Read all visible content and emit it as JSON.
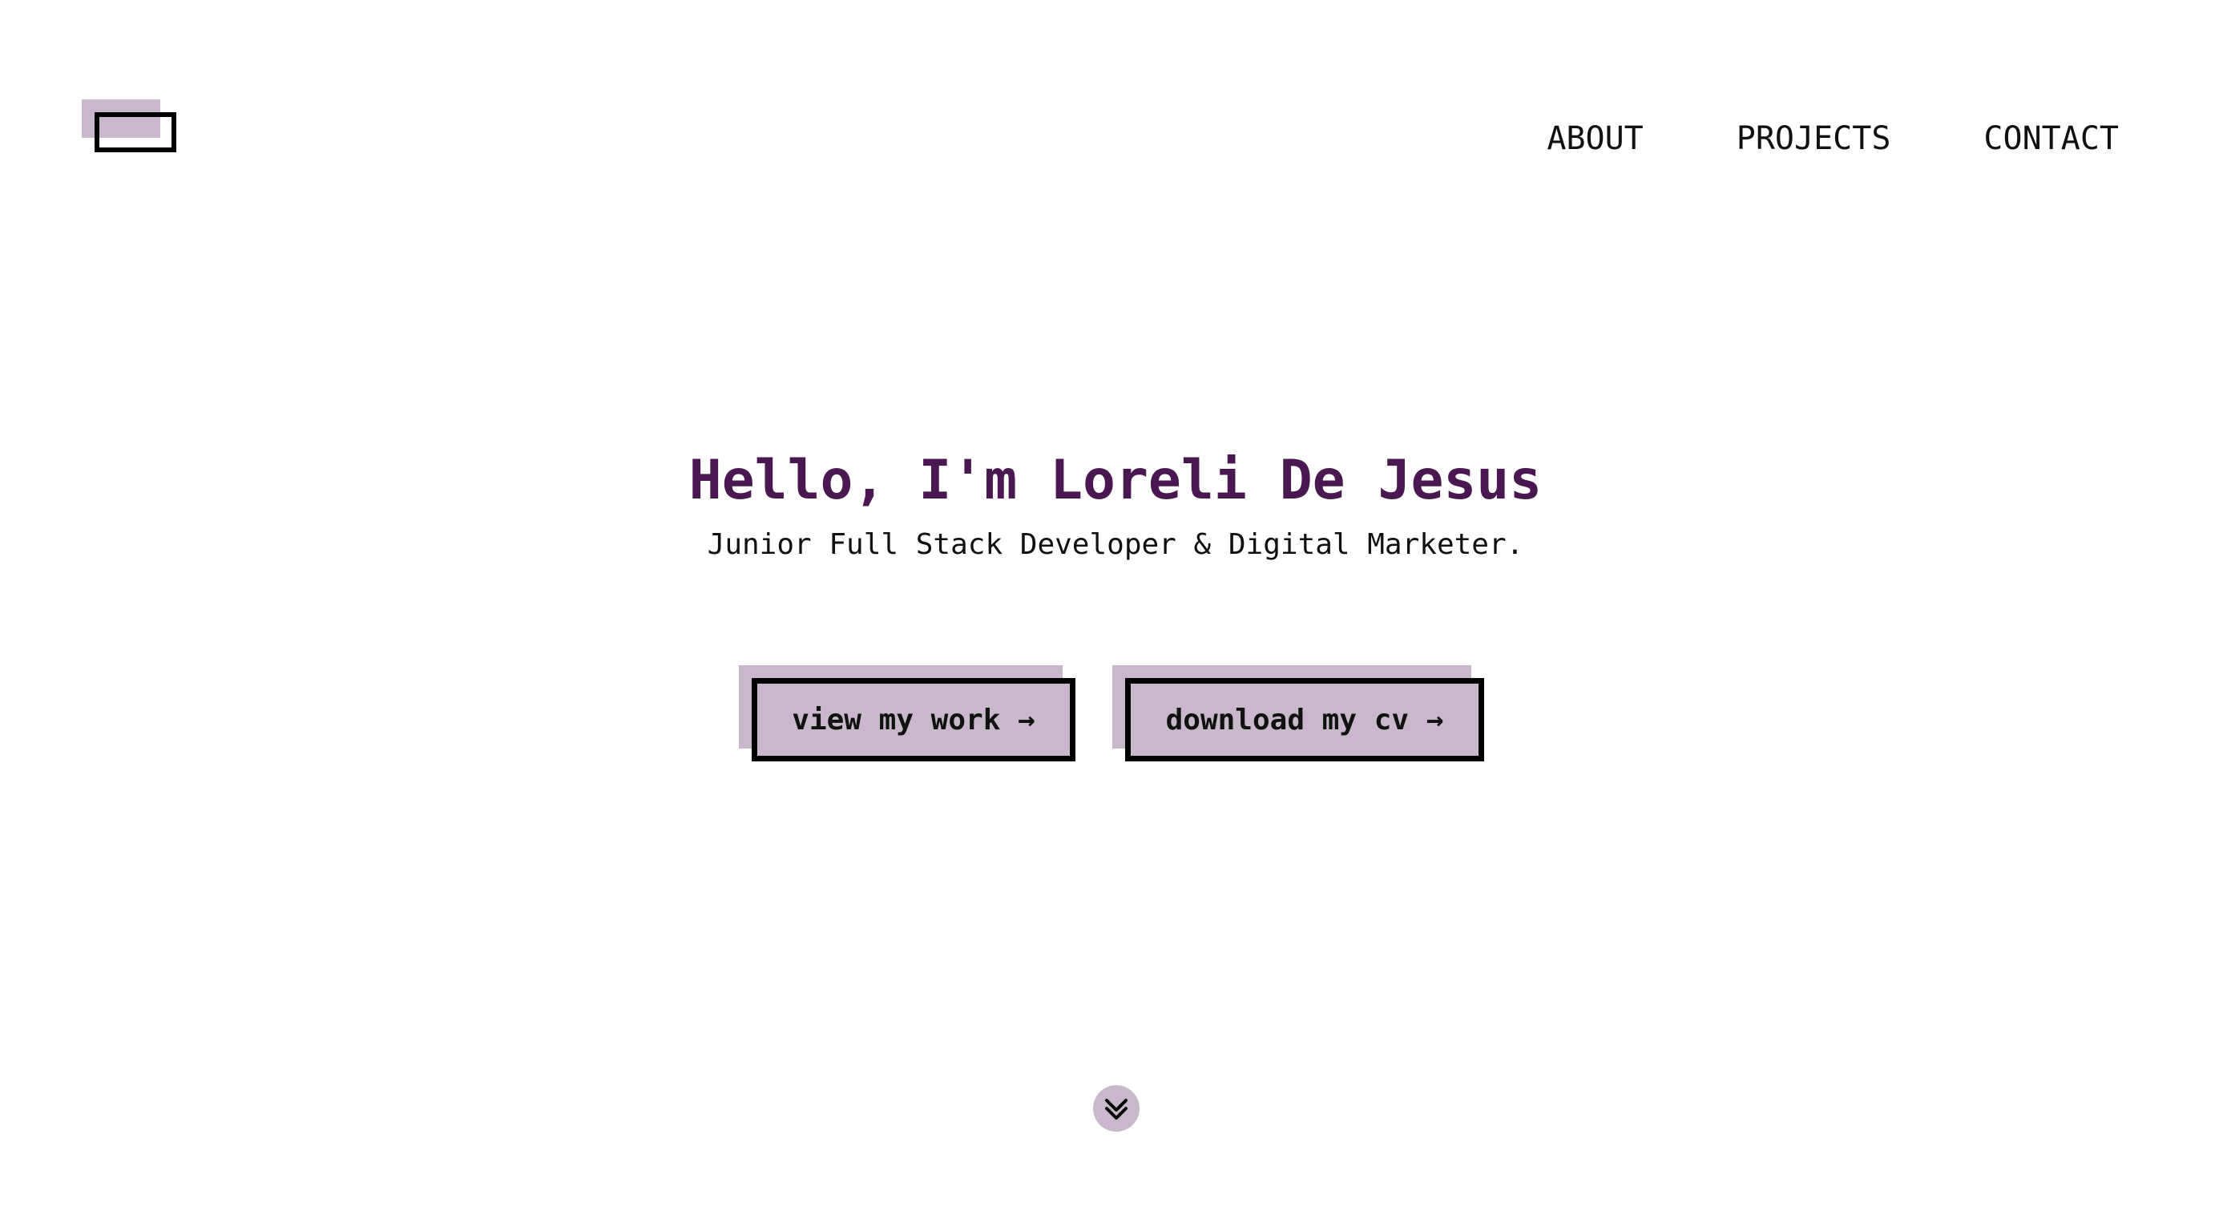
{
  "nav": {
    "items": [
      {
        "label": "ABOUT"
      },
      {
        "label": "PROJECTS"
      },
      {
        "label": "CONTACT"
      }
    ]
  },
  "hero": {
    "title": "Hello, I'm Loreli De Jesus",
    "subtitle": "Junior Full Stack Developer & Digital Marketer."
  },
  "buttons": {
    "view_work": "view my work →",
    "download_cv": "download my cv →"
  },
  "icons": {
    "logo": "logo-icon",
    "scroll": "double-chevron-down-icon"
  },
  "colors": {
    "accent": "#c9b8cb",
    "title": "#4a1850",
    "text": "#111111",
    "background": "#ffffff"
  }
}
